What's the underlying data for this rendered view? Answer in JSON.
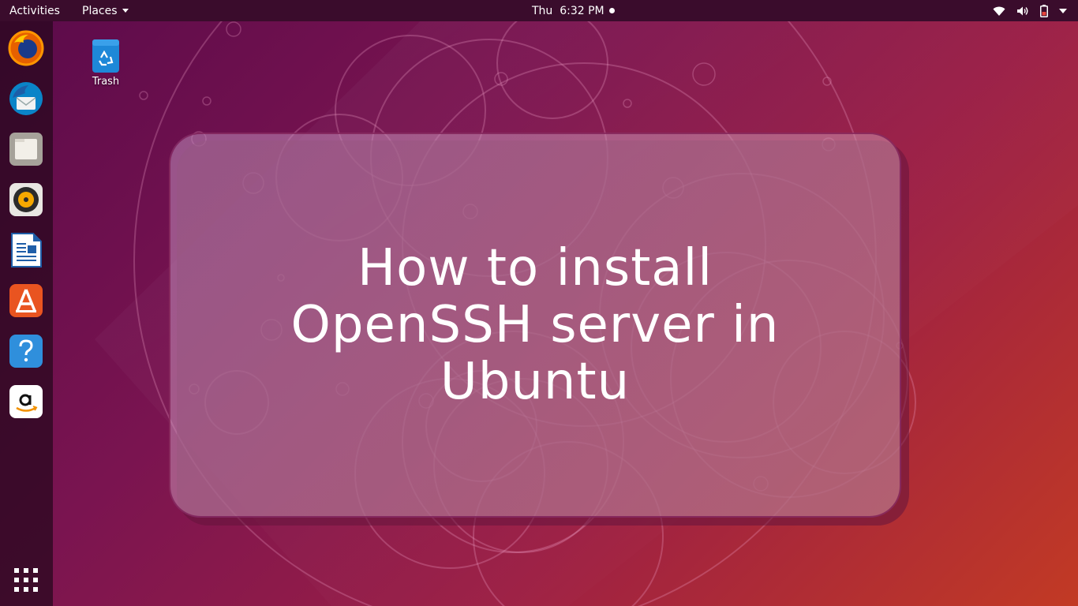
{
  "topbar": {
    "activities_label": "Activities",
    "places_label": "Places",
    "clock_label": "Thu  6:32 PM",
    "status_icons": [
      "wifi-icon",
      "volume-icon",
      "battery-icon",
      "system-menu-caret-icon"
    ]
  },
  "dock": {
    "items": [
      {
        "name": "firefox",
        "icon": "firefox-icon"
      },
      {
        "name": "thunderbird",
        "icon": "thunderbird-icon"
      },
      {
        "name": "files",
        "icon": "files-icon"
      },
      {
        "name": "rhythmbox",
        "icon": "rhythmbox-icon"
      },
      {
        "name": "libreoffice-writer",
        "icon": "writer-icon"
      },
      {
        "name": "ubuntu-software",
        "icon": "software-icon"
      },
      {
        "name": "help",
        "icon": "help-icon"
      },
      {
        "name": "amazon",
        "icon": "amazon-icon"
      }
    ],
    "show_apps_icon": "app-grid-icon"
  },
  "desktop": {
    "trash_label": "Trash"
  },
  "card": {
    "title": "How to install OpenSSH server in Ubuntu"
  },
  "colors": {
    "topbar": "#3a0c2c",
    "wallpaper_start": "#5a0a4a",
    "wallpaper_end": "#c23a24",
    "ubuntu_orange": "#e95420"
  }
}
